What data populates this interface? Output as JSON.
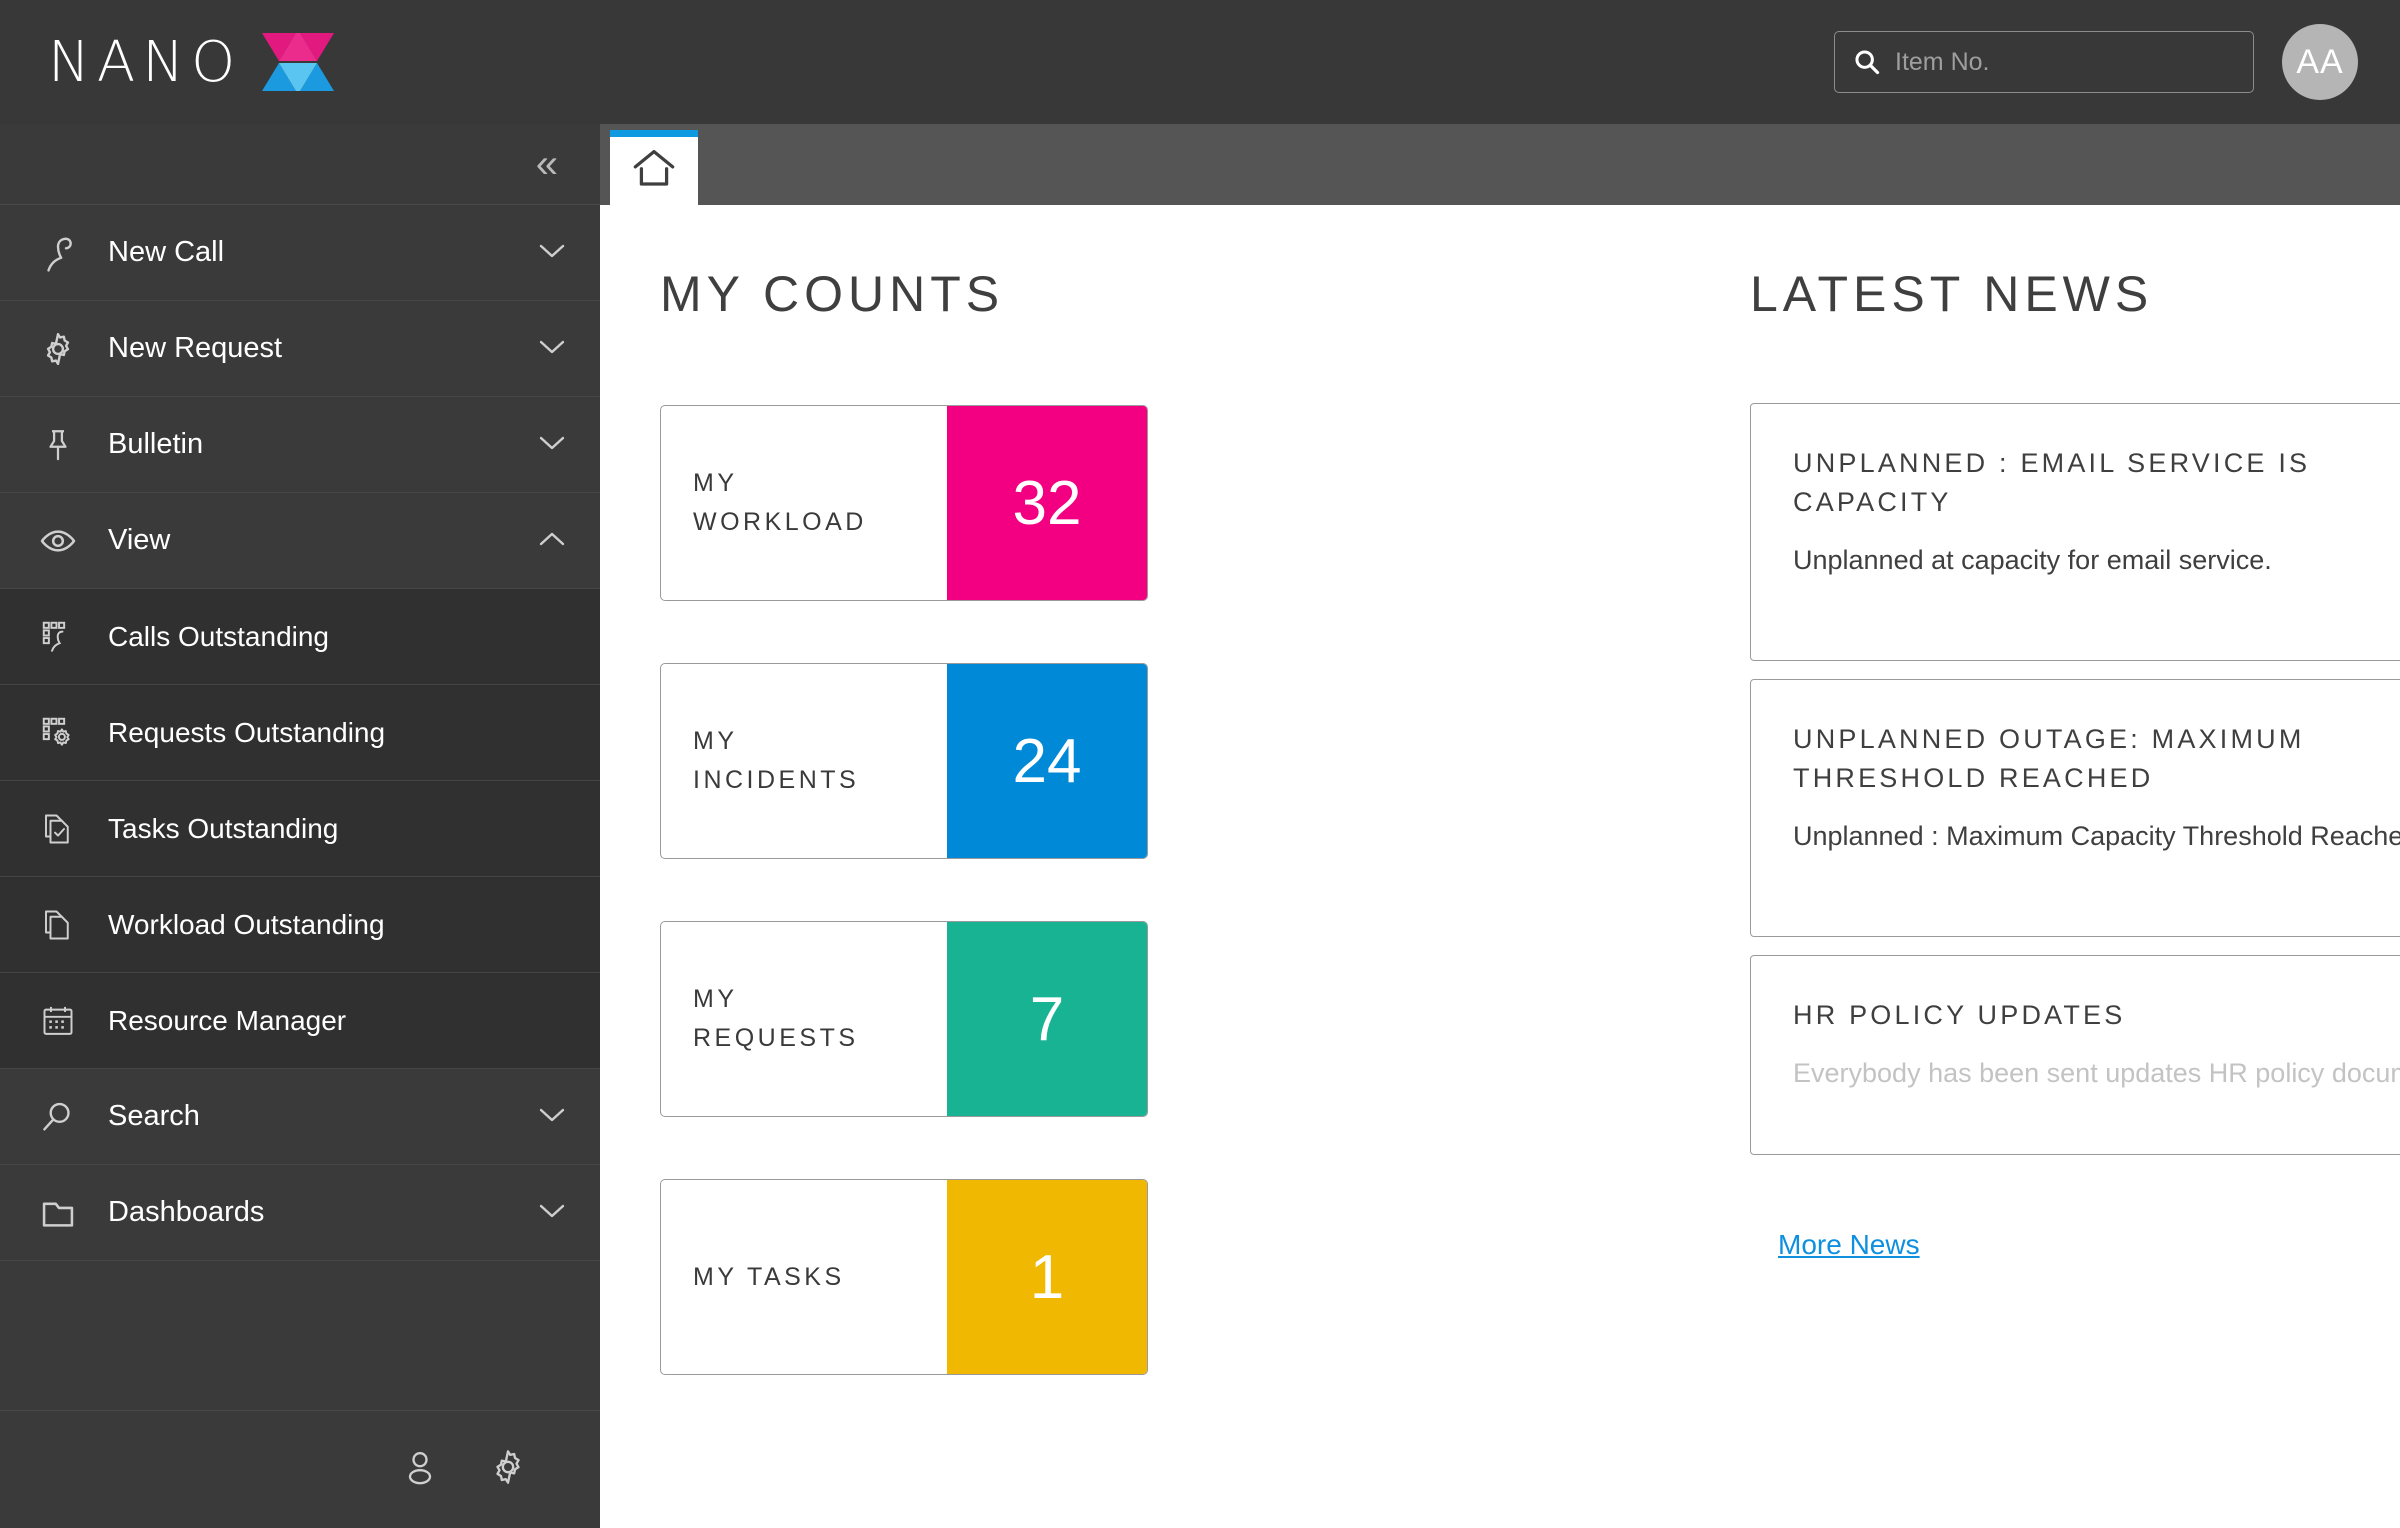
{
  "brand": {
    "name": "NANO",
    "mark_colors": {
      "pink_dark": "#E2197E",
      "pink_light": "#EC2C8C",
      "blue_dark": "#1C9AE0",
      "blue_light": "#5BC5F2"
    }
  },
  "header": {
    "search_placeholder": "Item No.",
    "search_value": "",
    "search_icon": "search-icon",
    "avatar_initials": "AA"
  },
  "sidebar": {
    "collapse_glyph": "«",
    "items": [
      {
        "label": "New Call",
        "icon": "phone-icon",
        "chevron": "⌄",
        "expanded": false,
        "sub": false
      },
      {
        "label": "New Request",
        "icon": "gear-icon",
        "chevron": "⌄",
        "expanded": false,
        "sub": false
      },
      {
        "label": "Bulletin",
        "icon": "pin-icon",
        "chevron": "⌄",
        "expanded": false,
        "sub": false
      },
      {
        "label": "View",
        "icon": "eye-icon",
        "chevron": "⌃",
        "expanded": true,
        "sub": false
      },
      {
        "label": "Calls Outstanding",
        "icon": "calls-grid-icon",
        "chevron": "",
        "expanded": false,
        "sub": true
      },
      {
        "label": "Requests Outstanding",
        "icon": "requests-grid-icon",
        "chevron": "",
        "expanded": false,
        "sub": true
      },
      {
        "label": "Tasks Outstanding",
        "icon": "task-docs-icon",
        "chevron": "",
        "expanded": false,
        "sub": true
      },
      {
        "label": "Workload Outstanding",
        "icon": "docs-icon",
        "chevron": "",
        "expanded": false,
        "sub": true
      },
      {
        "label": "Resource Manager",
        "icon": "calendar-icon",
        "chevron": "",
        "expanded": false,
        "sub": true
      },
      {
        "label": "Search",
        "icon": "magnifier-icon",
        "chevron": "⌄",
        "expanded": false,
        "sub": false
      },
      {
        "label": "Dashboards",
        "icon": "folder-icon",
        "chevron": "⌄",
        "expanded": false,
        "sub": false
      }
    ],
    "footer_icons": [
      "person-icon",
      "gear-icon"
    ]
  },
  "tabs": [
    {
      "label": "",
      "icon": "home-icon",
      "active": true
    }
  ],
  "counts": {
    "title": "MY COUNTS",
    "tiles": [
      {
        "label": "MY WORKLOAD",
        "value": "32",
        "color": "#F20081"
      },
      {
        "label": "MY INCIDENTS",
        "value": "24",
        "color": "#0089D6"
      },
      {
        "label": "MY REQUESTS",
        "value": "7",
        "color": "#17B392"
      },
      {
        "label": "MY TASKS",
        "value": "1",
        "color": "#F0B800"
      }
    ]
  },
  "news": {
    "title": "LATEST NEWS",
    "items": [
      {
        "title_line1": "UNPLANNED : EMAIL SERVICE IS",
        "title_line2": "CAPACITY",
        "body": "Unplanned at capacity for email service.",
        "faded": false
      },
      {
        "title_line1": "UNPLANNED OUTAGE: MAXIMUM",
        "title_line2": "THRESHOLD REACHED",
        "body": "Unplanned : Maximum Capacity Threshold Reached",
        "faded": false
      },
      {
        "title_line1": "HR POLICY UPDATES",
        "title_line2": "",
        "body": "Everybody has been sent updates HR policy documents",
        "faded": true
      }
    ],
    "more_link": "More News",
    "more_link_color": "#0E8FE0"
  }
}
